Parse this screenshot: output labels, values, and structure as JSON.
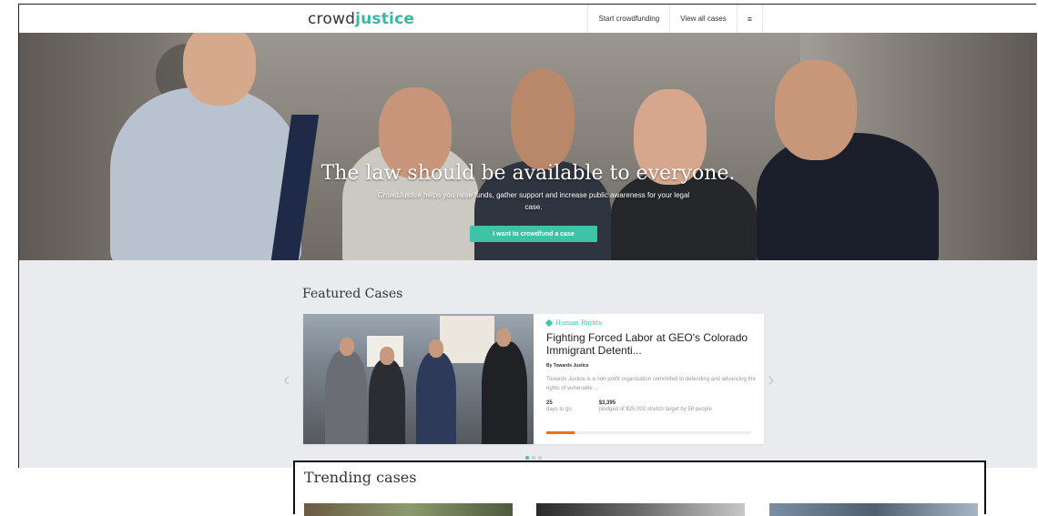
{
  "header": {
    "logo_part1": "crowd",
    "logo_part2": "justice",
    "nav": [
      "Start crowdfunding",
      "View all cases"
    ],
    "menu_icon": "menu-icon"
  },
  "hero": {
    "title": "The law should be available to everyone.",
    "subtitle": "CrowdJustice helps you raise funds, gather support and increase public awareness for your legal case.",
    "cta": "I want to crowdfund a case"
  },
  "featured": {
    "heading": "Featured Cases",
    "case": {
      "category": "Human Rights",
      "title": "Fighting Forced Labor at GEO's Colorado Immigrant Detenti...",
      "by": "By Towards Justice",
      "description": "Towards Justice is a non-profit organization committed to defending and advancing the rights of vulnerable ...",
      "days_value": "25",
      "days_label": "days to go",
      "pledged_value": "$3,395",
      "pledged_label": "pledged of $25,000 stretch target by 58 people",
      "progress_fraction": 0.136
    },
    "carousel_pages": 3,
    "carousel_active": 0
  },
  "trending": {
    "heading": "Trending cases"
  },
  "colors": {
    "accent": "#3ec3a7",
    "progress": "#f26b21"
  }
}
